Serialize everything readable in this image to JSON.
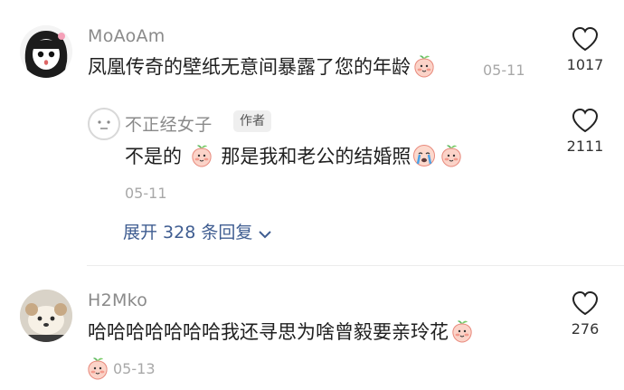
{
  "comments": [
    {
      "username": "MoAoAm",
      "text": "凤凰传奇的壁纸无意间暴露了您的年龄",
      "emoji": "peach-face-emoji",
      "date": "05-11",
      "likes": "1017"
    },
    {
      "username": "不正经女子",
      "badge": "作者",
      "text_part1": "不是的",
      "emoji1": "peach-face-emoji",
      "text_part2": "那是我和老公的结婚照",
      "emoji2": "crying-face-emoji",
      "emoji3": "peach-face-emoji",
      "date": "05-11",
      "likes": "2111"
    },
    {
      "username": "H2Mko",
      "text": "哈哈哈哈哈哈哈我还寻思为啥曾毅要亲玲花",
      "emoji": "peach-face-emoji",
      "date_emoji": "peach-face-emoji",
      "date": "05-13",
      "likes": "276"
    }
  ],
  "expand_replies": "展开 328 条回复",
  "colors": {
    "link": "#3f5d91",
    "muted": "#8a8a8a",
    "text": "#1f1f1f",
    "peach": "#f2a69a"
  }
}
